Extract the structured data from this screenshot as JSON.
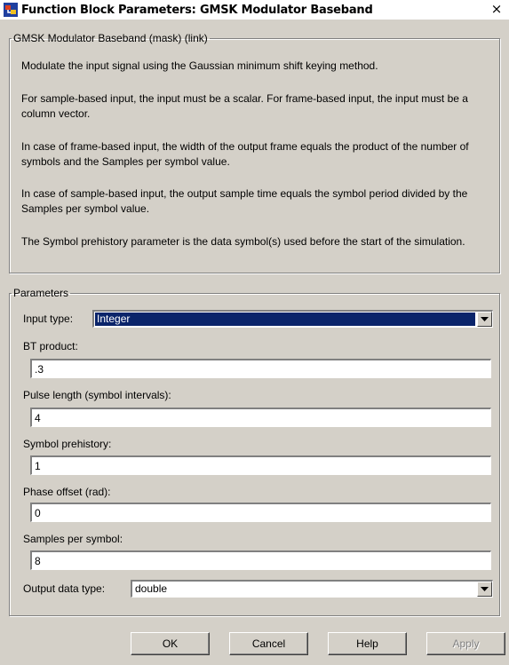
{
  "window": {
    "title": "Function Block Parameters: GMSK Modulator Baseband",
    "close_glyph": "×"
  },
  "description": {
    "legend": "GMSK Modulator Baseband (mask) (link)",
    "paragraphs": [
      "Modulate the input signal using the Gaussian minimum shift keying method.",
      "For sample-based input, the input must be a scalar. For frame-based input, the input must be a column vector.",
      "In case of frame-based input, the width of the output frame equals the product of the number of symbols and the Samples per symbol value.",
      "In case of sample-based input, the output sample time equals the symbol period divided by the Samples per symbol value.",
      "The Symbol prehistory parameter is the data symbol(s) used before the start of the simulation."
    ]
  },
  "parameters": {
    "legend": "Parameters",
    "input_type": {
      "label": "Input type:",
      "value": "Integer"
    },
    "bt_product": {
      "label": "BT product:",
      "value": ".3"
    },
    "pulse_length": {
      "label": "Pulse length (symbol intervals):",
      "value": "4"
    },
    "symbol_prehistory": {
      "label": "Symbol prehistory:",
      "value": "1"
    },
    "phase_offset": {
      "label": "Phase offset (rad):",
      "value": "0"
    },
    "samples_per_symbol": {
      "label": "Samples per symbol:",
      "value": "8"
    },
    "output_data_type": {
      "label": "Output data type:",
      "value": "double"
    }
  },
  "buttons": {
    "ok": "OK",
    "cancel": "Cancel",
    "help": "Help",
    "apply": "Apply"
  },
  "icons": {
    "app": "simulink-block-icon",
    "close": "close-icon",
    "dropdown": "chevron-down-icon"
  }
}
